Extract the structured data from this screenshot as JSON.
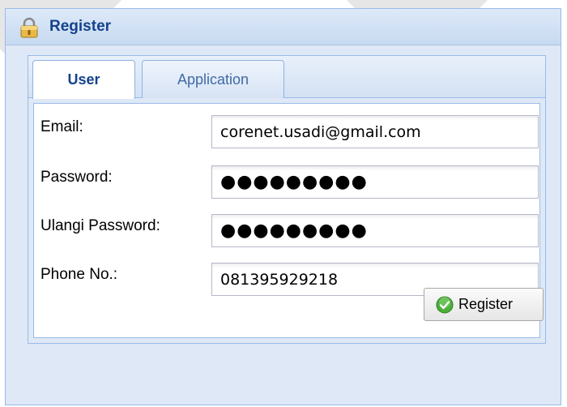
{
  "window": {
    "title": "Register"
  },
  "tabs": [
    {
      "label": "User",
      "active": true
    },
    {
      "label": "Application",
      "active": false
    }
  ],
  "form": {
    "email_label": "Email:",
    "email_value": "corenet.usadi@gmail.com",
    "password_label": "Password:",
    "password_value": "●●●●●●●●●",
    "repeat_label": "Ulangi Password:",
    "repeat_value": "●●●●●●●●●",
    "phone_label": "Phone No.:",
    "phone_value": "081395929218"
  },
  "actions": {
    "register_label": "Register"
  },
  "colors": {
    "title": "#15428b",
    "border": "#99bbe8",
    "panel_bg": "#dfe8f6",
    "accent_green": "#3d9a2b"
  },
  "icons": {
    "title": "lock-icon",
    "register": "check-circle-icon"
  }
}
